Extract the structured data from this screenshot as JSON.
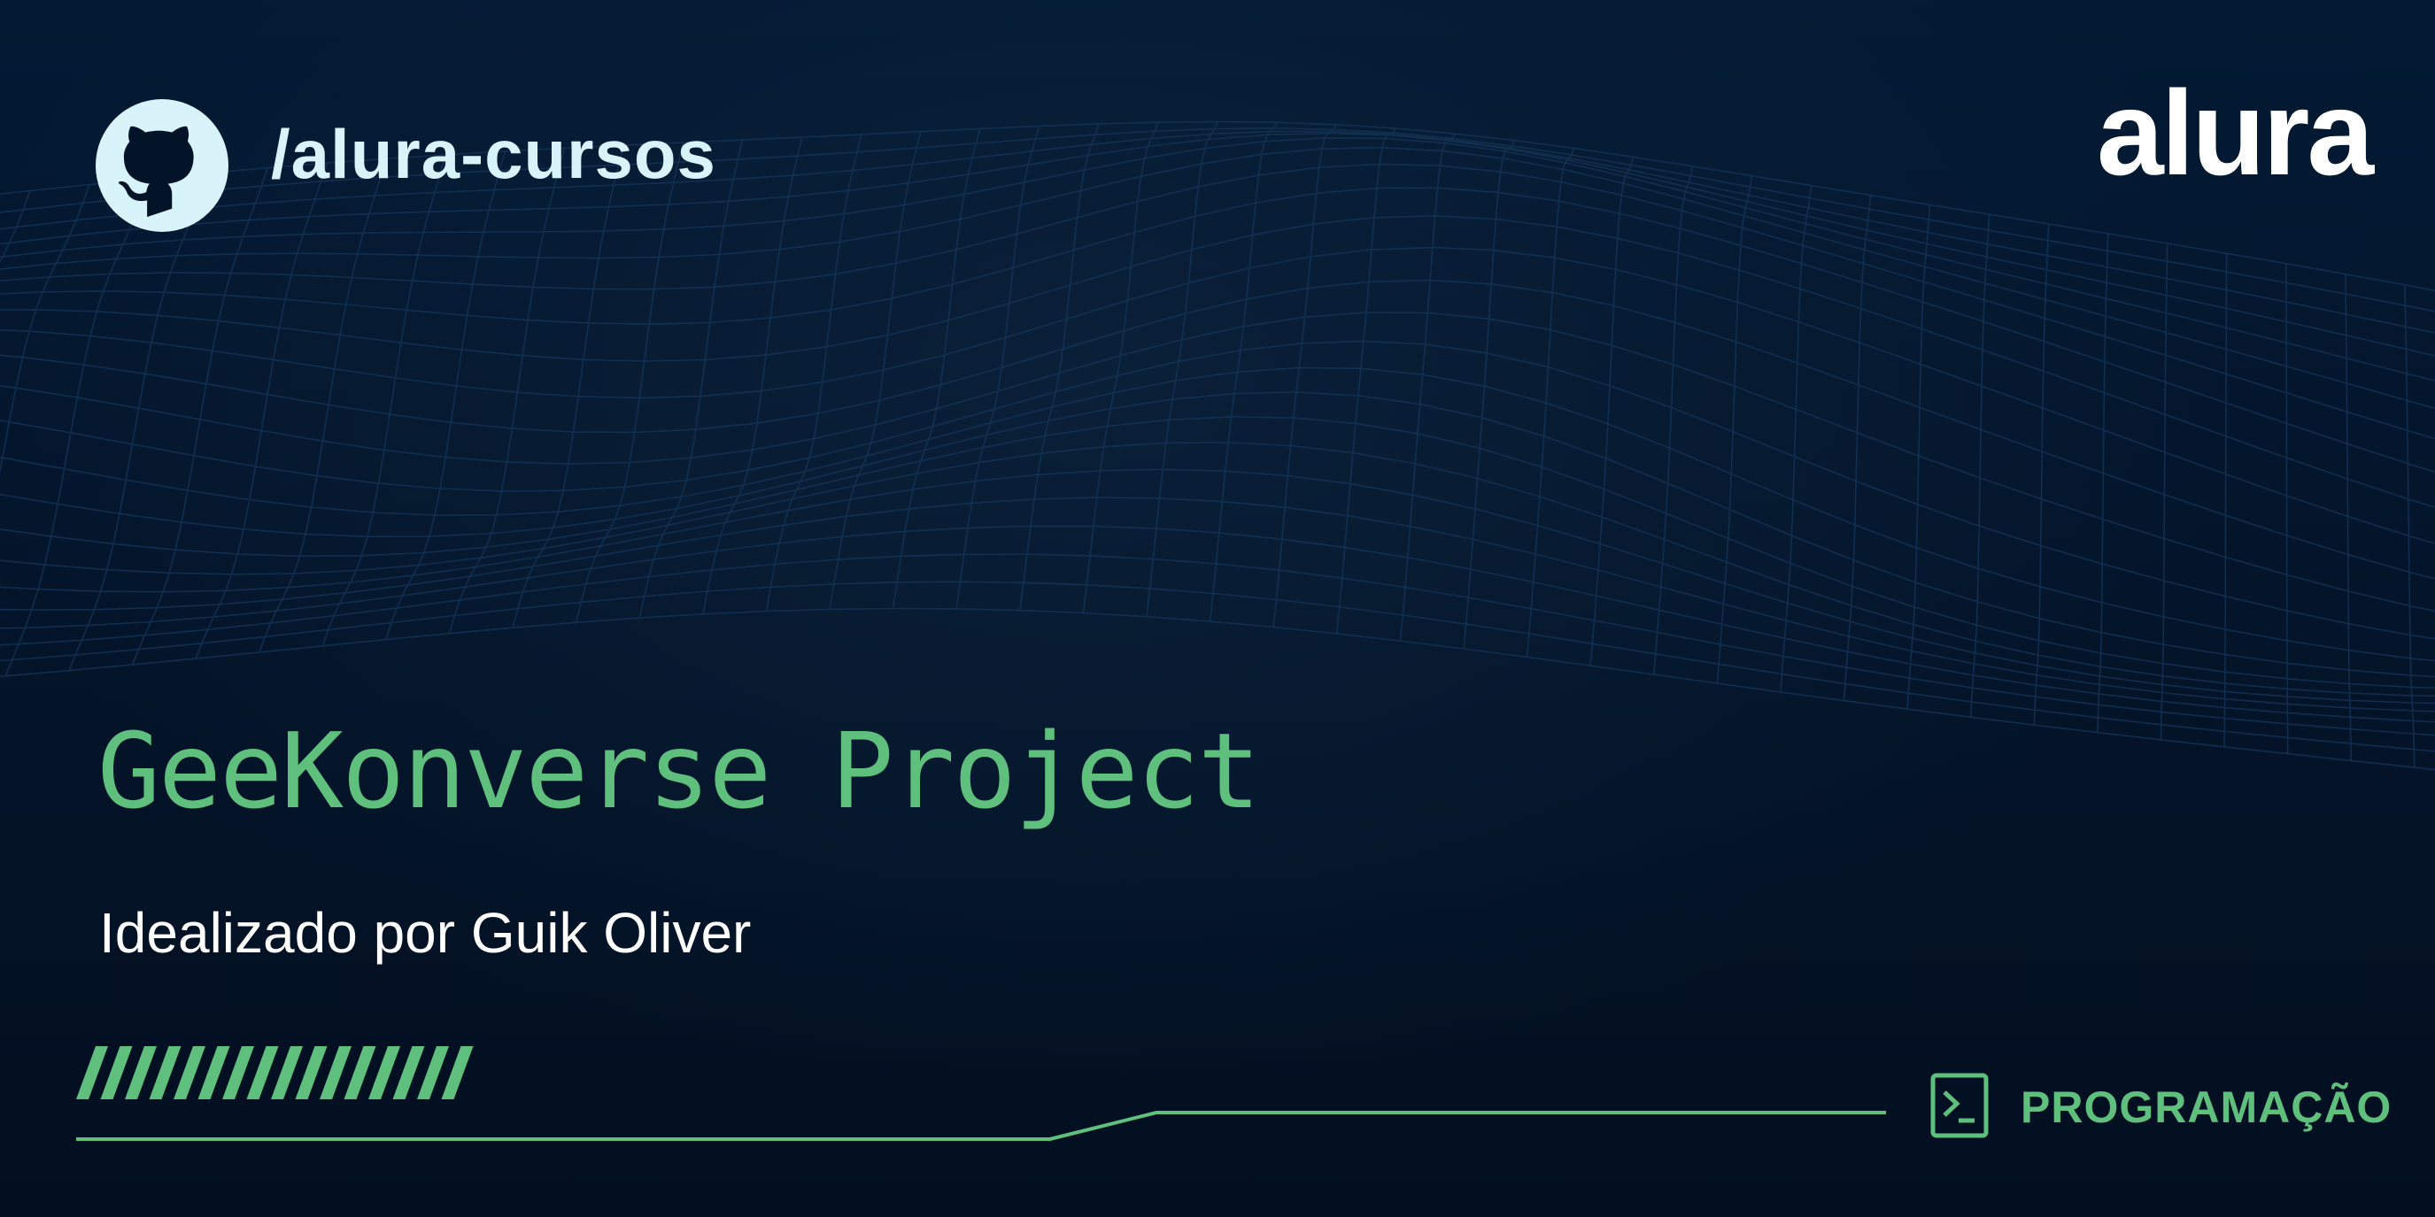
{
  "header": {
    "repo_handle": "/alura-cursos",
    "github_icon": "github-octocat-icon",
    "brand_logo_text": "alura"
  },
  "main": {
    "title": "GeeKonverse Project",
    "subtitle": "Idealizado por Guik Oliver"
  },
  "footer": {
    "category_icon": "terminal-prompt-icon",
    "category_label": "PROGRAMAÇÃO"
  },
  "colors": {
    "background": "#041428",
    "accent_green": "#5ec07c",
    "mesh_blue": "#17355a",
    "text_white": "#ffffff",
    "handle_text": "#d9f3fb"
  }
}
